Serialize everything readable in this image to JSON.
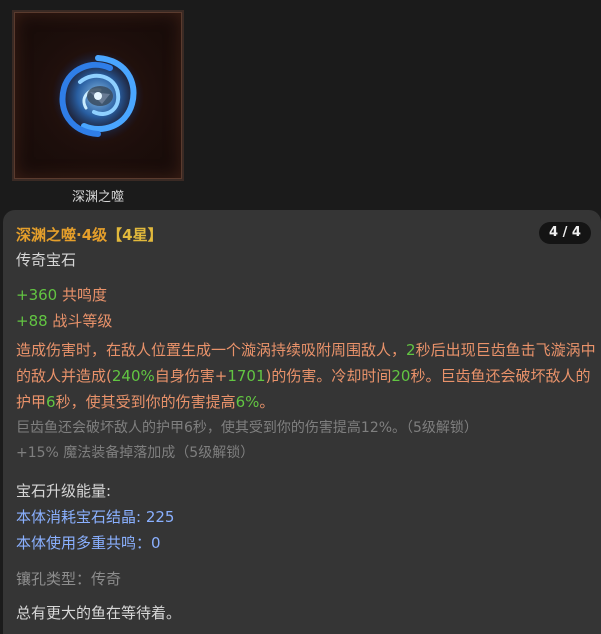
{
  "gem": {
    "caption": "深渊之噬",
    "icon": "swirl-gem-icon"
  },
  "tooltip": {
    "title": "深渊之噬·4级",
    "stars": "【4星】",
    "counter": "4 / 4",
    "type": "传奇宝石",
    "stats": [
      {
        "value": "+360",
        "label": " 共鸣度"
      },
      {
        "value": "+88",
        "label": " 战斗等级"
      }
    ],
    "description": [
      {
        "text": "造成伤害时，在敌人位置生成一个漩涡持续吸附周围敌人，",
        "hl": false
      },
      {
        "text": "2",
        "hl": true
      },
      {
        "text": "秒后出现巨齿鱼击飞漩涡中的敌人并造成(",
        "hl": false
      },
      {
        "text": "240%",
        "hl": true
      },
      {
        "text": "自身伤害+",
        "hl": false
      },
      {
        "text": "1701",
        "hl": true
      },
      {
        "text": ")的伤害。冷却时间",
        "hl": false
      },
      {
        "text": "20",
        "hl": true
      },
      {
        "text": "秒。巨齿鱼还会破坏敌人的护甲",
        "hl": false
      },
      {
        "text": "6",
        "hl": true
      },
      {
        "text": "秒，使其受到你的伤害提高",
        "hl": false
      },
      {
        "text": "6%",
        "hl": true
      },
      {
        "text": "。",
        "hl": false
      }
    ],
    "locked": [
      "巨齿鱼还会破坏敌人的护甲6秒，使其受到你的伤害提高12%。（5级解锁）",
      "+15% 魔法装备掉落加成（5级解锁）"
    ],
    "upgrade_header": "宝石升级能量:",
    "upgrade_lines": [
      "本体消耗宝石结晶:  225",
      "本体使用多重共鸣：0"
    ],
    "socket_type": "镶孔类型：传奇",
    "flavor": "总有更大的鱼在等待着。"
  },
  "colors": {
    "background": "#1b1b1b",
    "panel": "#353535",
    "title": "#e59f2b",
    "highlight_green": "#62c542",
    "body_text": "#e9926a",
    "locked_text": "#7f7f7f",
    "energy_blue": "#8ab0ff"
  }
}
